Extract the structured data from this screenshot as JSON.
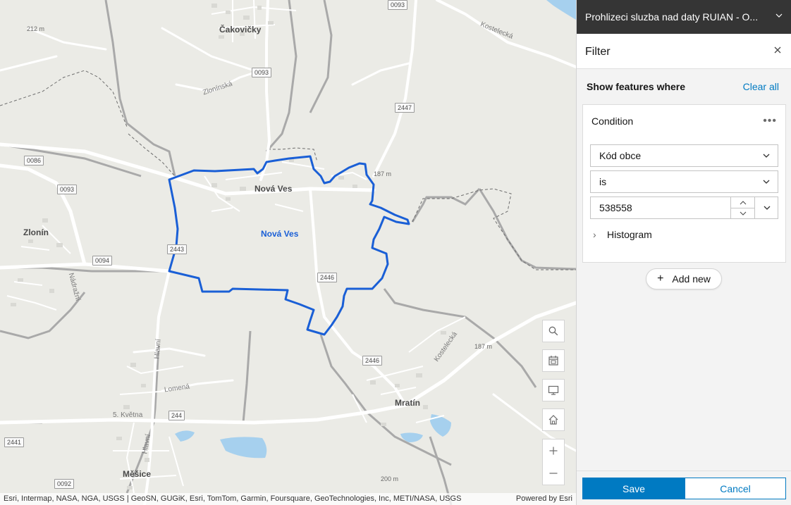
{
  "map": {
    "towns": {
      "cakovicky": "Čakovičky",
      "nova_ves": "Nová Ves",
      "zlonin": "Zlonín",
      "mratin": "Mratín",
      "mesice": "Měšice"
    },
    "polygon_label": "Nová Ves",
    "streets": {
      "zloninska": "Zlonínská",
      "kostelecka_top": "Kostelecká",
      "kostelecka_bottom": "Kostelecká",
      "nadrazni": "Nádražní",
      "hlavni_top": "Hlavní",
      "hlavni_bottom": "Hlavní",
      "lomena": "Lomená",
      "petkvetna": "5. Května"
    },
    "elevations": {
      "e212": "212 m",
      "e187a": "187 m",
      "e187b": "187 m",
      "e200": "200 m"
    },
    "road_shields": {
      "s0093_top": "0093",
      "s0093_mid": "0093",
      "s2447": "2447",
      "s0086": "0086",
      "s0093_left": "0093",
      "s2443": "2443",
      "s0094": "0094",
      "s2446_a": "2446",
      "s2446_b": "2446",
      "s244": "244",
      "s2441": "2441",
      "s0092": "0092"
    },
    "attribution": "Esri, Intermap, NASA, NGA, USGS | GeoSN, GUGiK, Esri, TomTom, Garmin, Foursquare, GeoTechnologies, Inc, METI/NASA, USGS",
    "powered_by": "Powered by Esri",
    "colors": {
      "boundary": "#1a5fd6",
      "water": "#a6d0ee"
    }
  },
  "panel": {
    "title": "Prohlizeci sluzba nad daty RUIAN - O...",
    "filter_title": "Filter",
    "show_features_where": "Show features where",
    "clear_all": "Clear all",
    "condition": {
      "title": "Condition",
      "field": "Kód obce",
      "operator": "is",
      "value": "538558",
      "histogram": "Histogram"
    },
    "add_new": "Add new",
    "save": "Save",
    "cancel": "Cancel",
    "colors": {
      "accent": "#007ac2",
      "header": "#353535"
    }
  }
}
